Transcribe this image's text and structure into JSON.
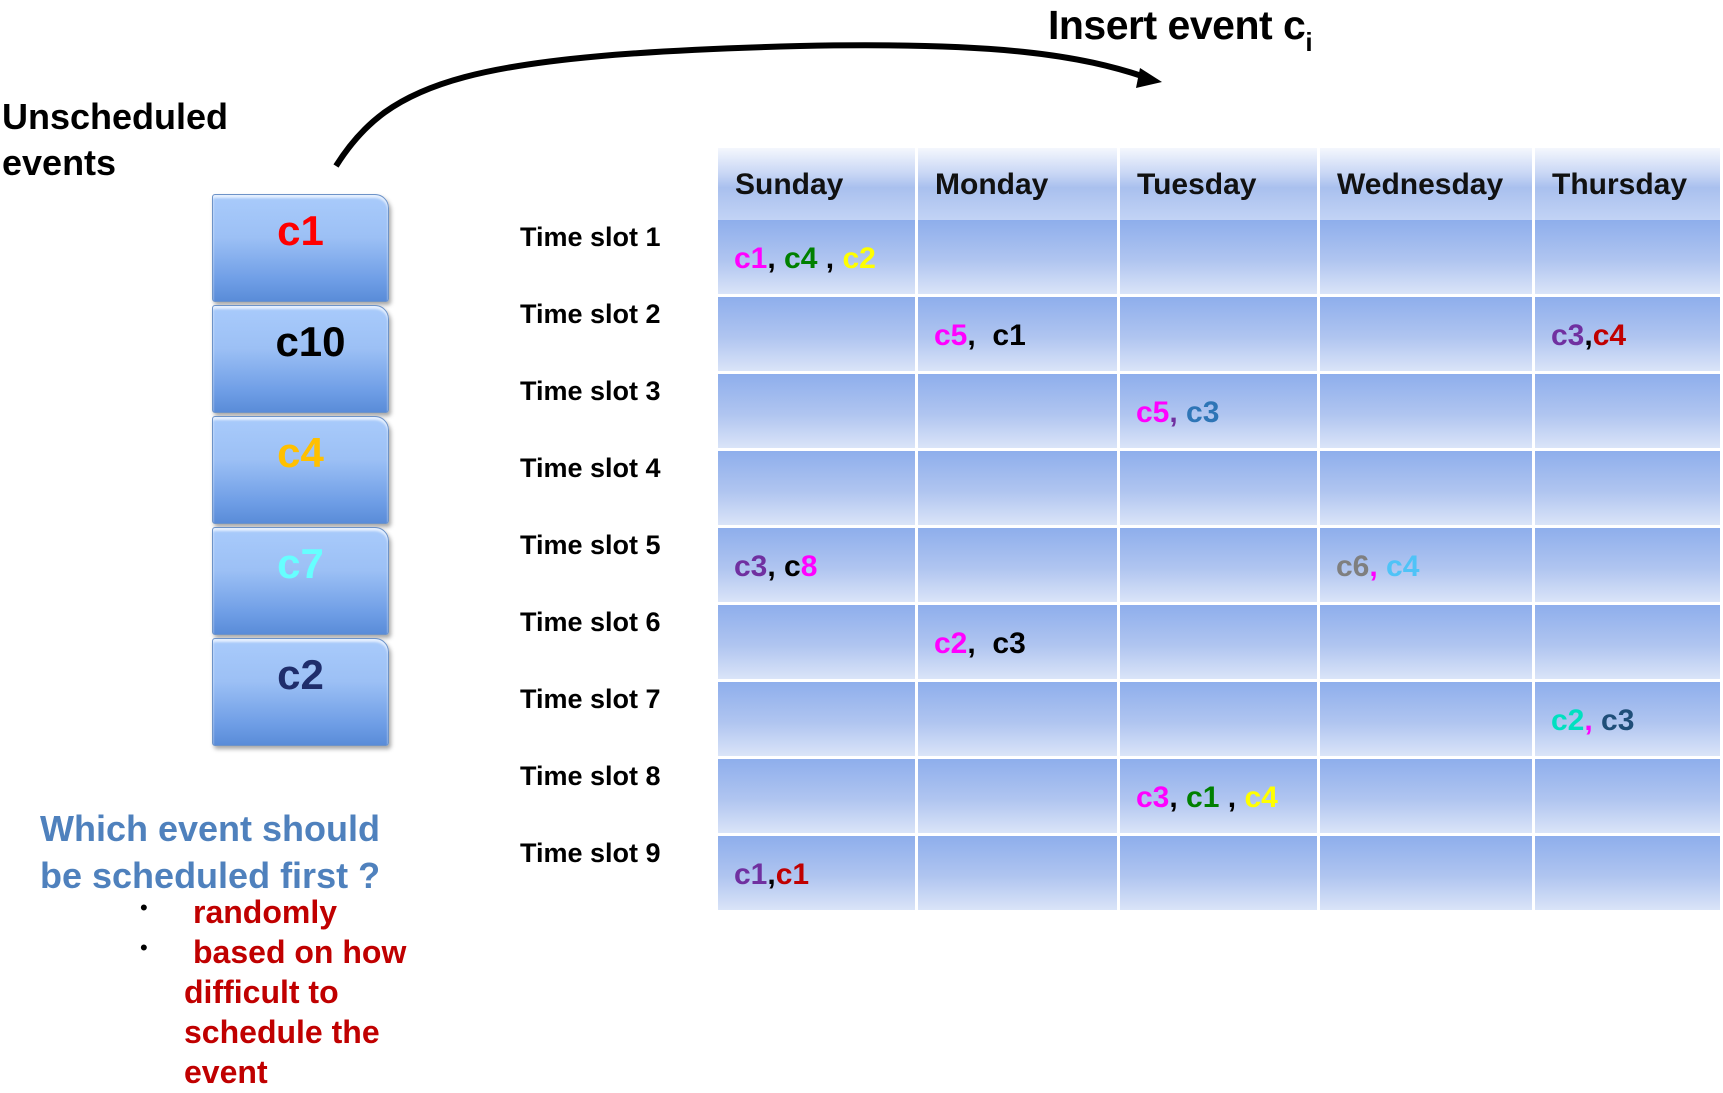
{
  "title": {
    "text": "Insert event c",
    "subscript": "i"
  },
  "unscheduled_label": "Unscheduled events",
  "unscheduled_events": [
    {
      "label": "c1",
      "color": "#ff0000"
    },
    {
      "label": "c10",
      "color": "#000000"
    },
    {
      "label": "c4",
      "color": "#ffc000"
    },
    {
      "label": "c7",
      "color": "#66ffff"
    },
    {
      "label": "c2",
      "color": "#1f2d6b"
    }
  ],
  "question": {
    "line1": "Which event should",
    "line2": "be scheduled first ?",
    "bullet": "•",
    "options": [
      {
        "text": "randomly"
      },
      {
        "lines": [
          "based on how",
          "difficult to",
          "schedule the",
          "event"
        ]
      }
    ]
  },
  "timetable": {
    "days": [
      "Sunday",
      "Monday",
      "Tuesday",
      "Wednesday",
      "Thursday"
    ],
    "slots": [
      "Time slot 1",
      "Time slot 2",
      "Time slot 3",
      "Time slot 4",
      "Time slot 5",
      "Time slot 6",
      "Time slot 7",
      "Time slot 8",
      "Time slot 9"
    ],
    "entries": [
      {
        "slot": 0,
        "day": 0,
        "parts": [
          {
            "t": "c1",
            "c": "#ff00ff"
          },
          {
            "t": ", ",
            "c": "#000000"
          },
          {
            "t": "c4",
            "c": "#008000"
          },
          {
            "t": " , ",
            "c": "#000000"
          },
          {
            "t": "c2",
            "c": "#ffff00"
          }
        ]
      },
      {
        "slot": 1,
        "day": 1,
        "parts": [
          {
            "t": "c5",
            "c": "#ff00ff"
          },
          {
            "t": ",  c1",
            "c": "#000000"
          }
        ]
      },
      {
        "slot": 1,
        "day": 4,
        "parts": [
          {
            "t": "c3",
            "c": "#7030a0"
          },
          {
            "t": ",",
            "c": "#000000"
          },
          {
            "t": "c4",
            "c": "#c00000"
          }
        ]
      },
      {
        "slot": 2,
        "day": 2,
        "parts": [
          {
            "t": "c5",
            "c": "#ff00ff"
          },
          {
            "t": ", ",
            "c": "#7030a0"
          },
          {
            "t": "c3",
            "c": "#2e75b6"
          }
        ]
      },
      {
        "slot": 4,
        "day": 0,
        "parts": [
          {
            "t": "c3",
            "c": "#7030a0"
          },
          {
            "t": ", c",
            "c": "#000000"
          },
          {
            "t": "8",
            "c": "#ff00ff"
          }
        ]
      },
      {
        "slot": 4,
        "day": 3,
        "parts": [
          {
            "t": "c6",
            "c": "#7f7f7f"
          },
          {
            "t": ", ",
            "c": "#ff00ff"
          },
          {
            "t": "c4",
            "c": "#4fc3f7"
          }
        ]
      },
      {
        "slot": 5,
        "day": 1,
        "parts": [
          {
            "t": "c2",
            "c": "#ff00ff"
          },
          {
            "t": ",  c3",
            "c": "#000000"
          }
        ]
      },
      {
        "slot": 6,
        "day": 4,
        "parts": [
          {
            "t": "c2",
            "c": "#00e0c0"
          },
          {
            "t": ", ",
            "c": "#ff00ff"
          },
          {
            "t": "c3",
            "c": "#1f4e79"
          }
        ]
      },
      {
        "slot": 7,
        "day": 2,
        "parts": [
          {
            "t": "c3",
            "c": "#ff00ff"
          },
          {
            "t": ", ",
            "c": "#000000"
          },
          {
            "t": "c1",
            "c": "#008000"
          },
          {
            "t": " , ",
            "c": "#000000"
          },
          {
            "t": "c4",
            "c": "#ffff00"
          }
        ]
      },
      {
        "slot": 8,
        "day": 0,
        "parts": [
          {
            "t": "c1",
            "c": "#7030a0"
          },
          {
            "t": ",",
            "c": "#000000"
          },
          {
            "t": "c1",
            "c": "#c00000"
          }
        ]
      }
    ]
  }
}
